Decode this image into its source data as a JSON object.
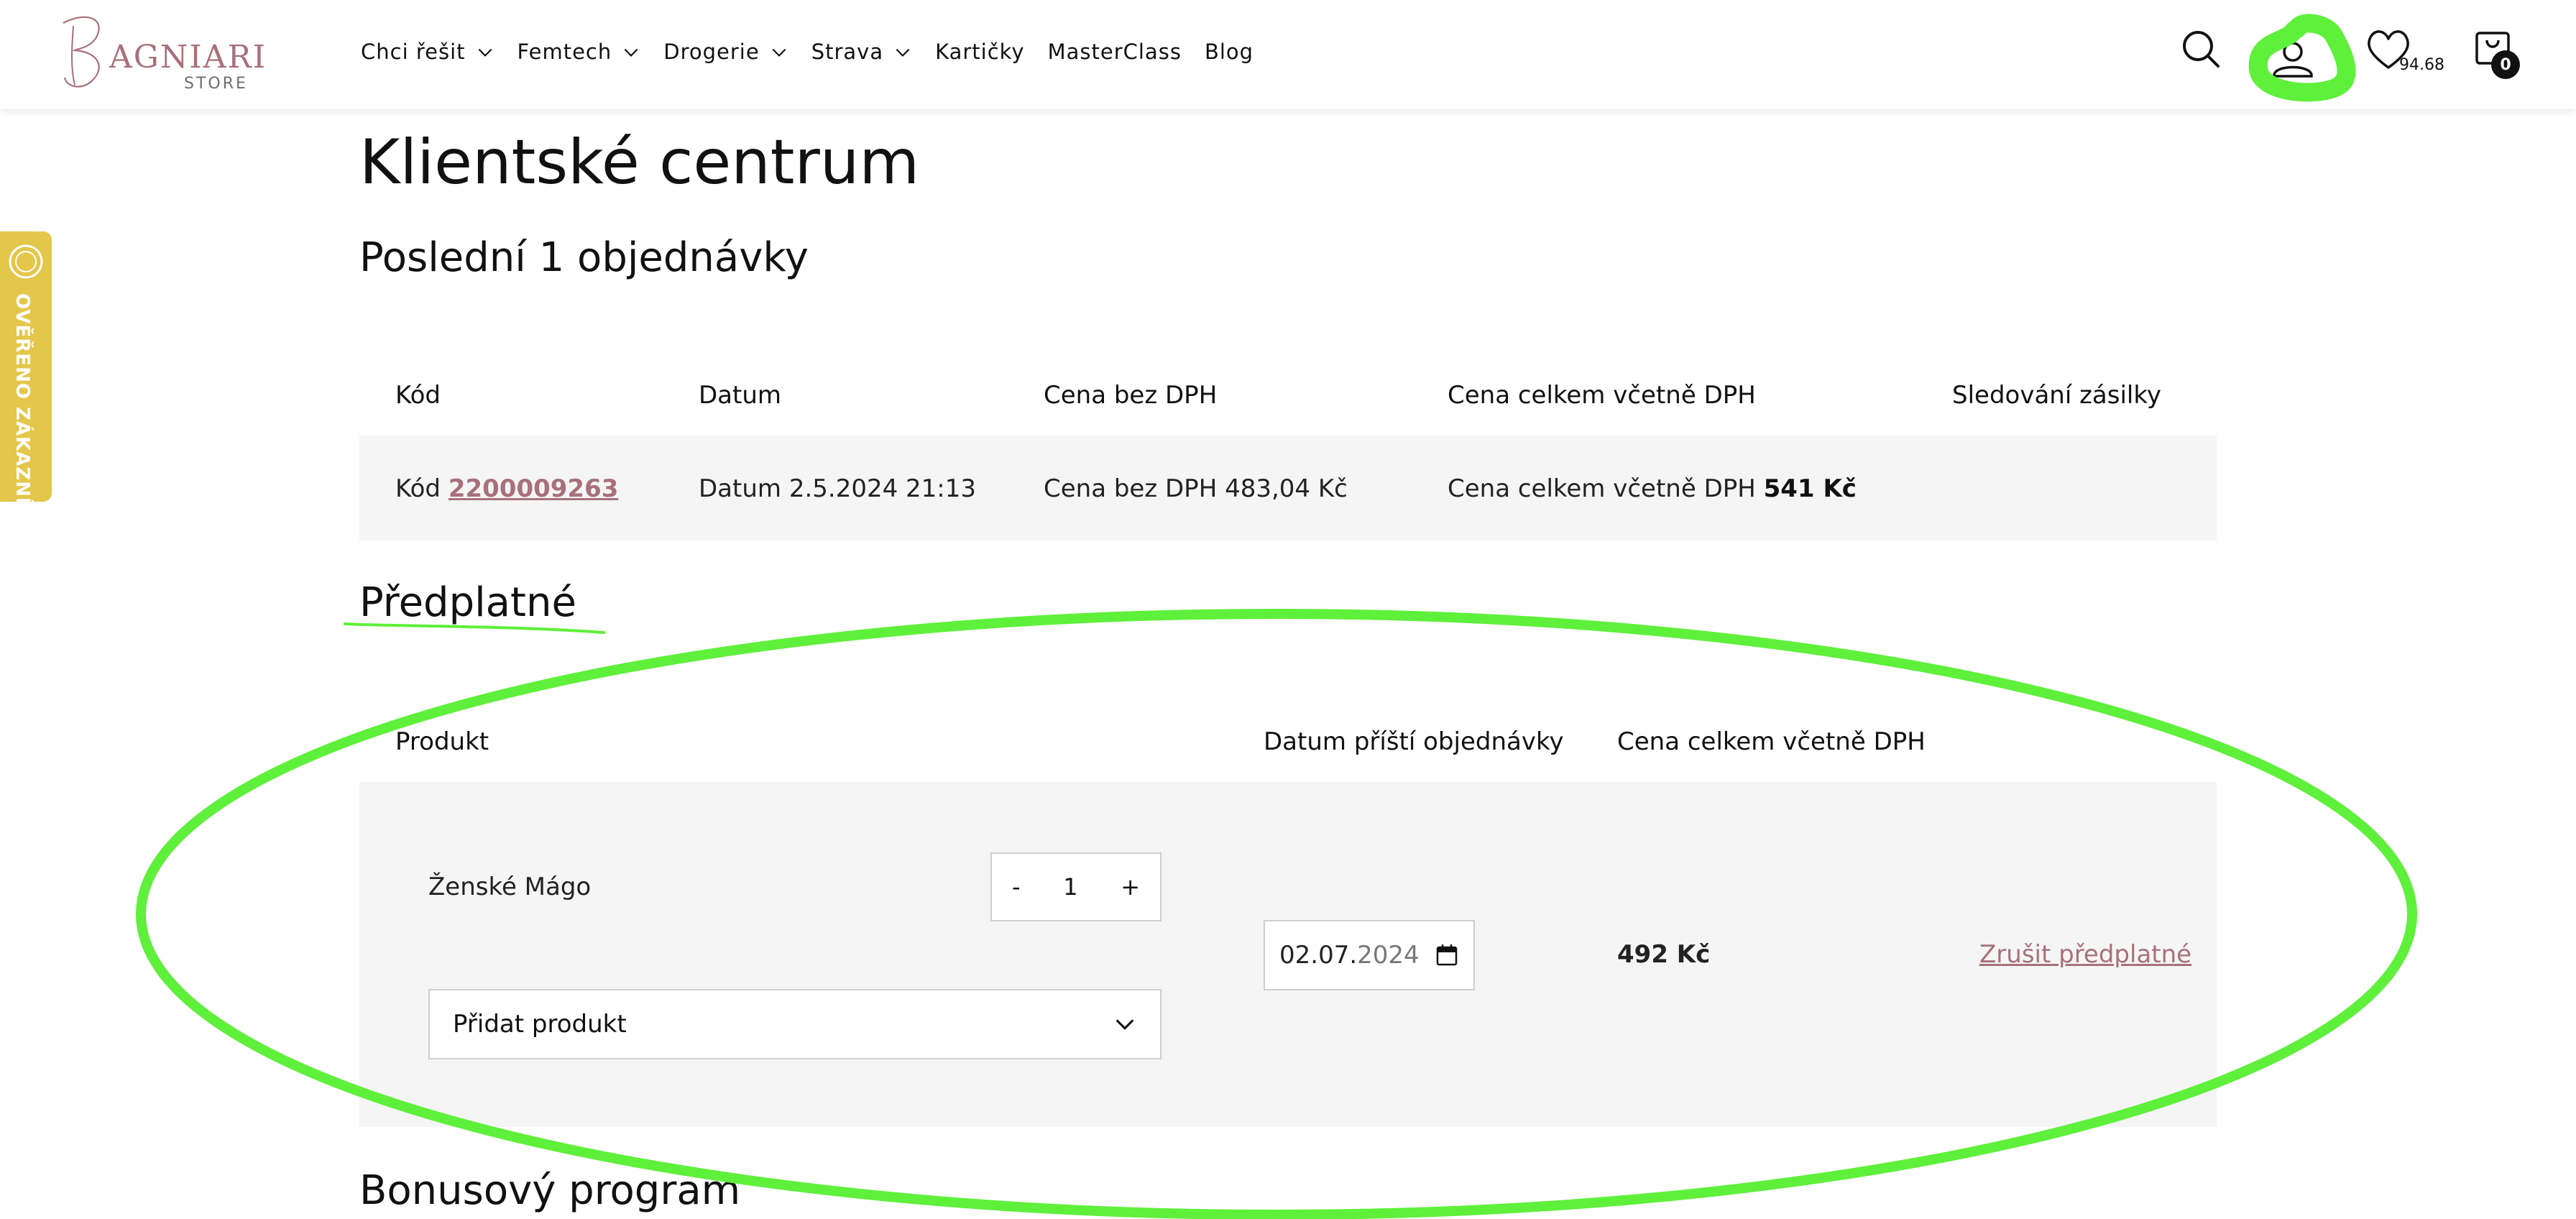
{
  "logo": {
    "brand": "AGNIARI",
    "sub": "STORE",
    "initial": "B"
  },
  "nav": [
    {
      "label": "Chci řešit",
      "has_dropdown": true
    },
    {
      "label": "Femtech",
      "has_dropdown": true
    },
    {
      "label": "Drogerie",
      "has_dropdown": true
    },
    {
      "label": "Strava",
      "has_dropdown": true
    },
    {
      "label": "Kartičky",
      "has_dropdown": false
    },
    {
      "label": "MasterClass",
      "has_dropdown": false
    },
    {
      "label": "Blog",
      "has_dropdown": false
    }
  ],
  "header_icons": {
    "search": "search-icon",
    "account": "user-icon",
    "wishlist": "heart-icon",
    "wishlist_value": "94.68",
    "cart": "cart-icon",
    "cart_count": "0"
  },
  "side_badge": {
    "label": "OVĚŘENO ZÁKAZNÍKY"
  },
  "page": {
    "title": "Klientské centrum"
  },
  "orders": {
    "heading": "Poslední 1 objednávky",
    "columns": [
      "Kód",
      "Datum",
      "Cena bez DPH",
      "Cena celkem včetně DPH",
      "Sledování zásilky"
    ],
    "rows": [
      {
        "code_label": "Kód",
        "code": "2200009263",
        "date_label": "Datum",
        "date": "2.5.2024 21:13",
        "net_label": "Cena bez DPH",
        "net": "483,04 Kč",
        "total_label": "Cena celkem včetně DPH",
        "total": "541 Kč"
      }
    ]
  },
  "subscription": {
    "heading": "Předplatné",
    "columns": [
      "Produkt",
      "Datum příští objednávky",
      "Cena celkem včetně DPH"
    ],
    "item": {
      "product": "Ženské Mágo",
      "minus": "-",
      "qty": "1",
      "plus": "+",
      "add_product": "Přidat produkt",
      "next_date_dm": "02.07.",
      "next_date_y": "2024",
      "price": "492 Kč",
      "cancel": "Zrušit předplatné"
    }
  },
  "bonus": {
    "heading": "Bonusový program"
  },
  "colors": {
    "accent": "#a8707b",
    "annotation": "#5ef03a",
    "badge": "#e4c64a",
    "row_bg": "#f5f5f5"
  }
}
